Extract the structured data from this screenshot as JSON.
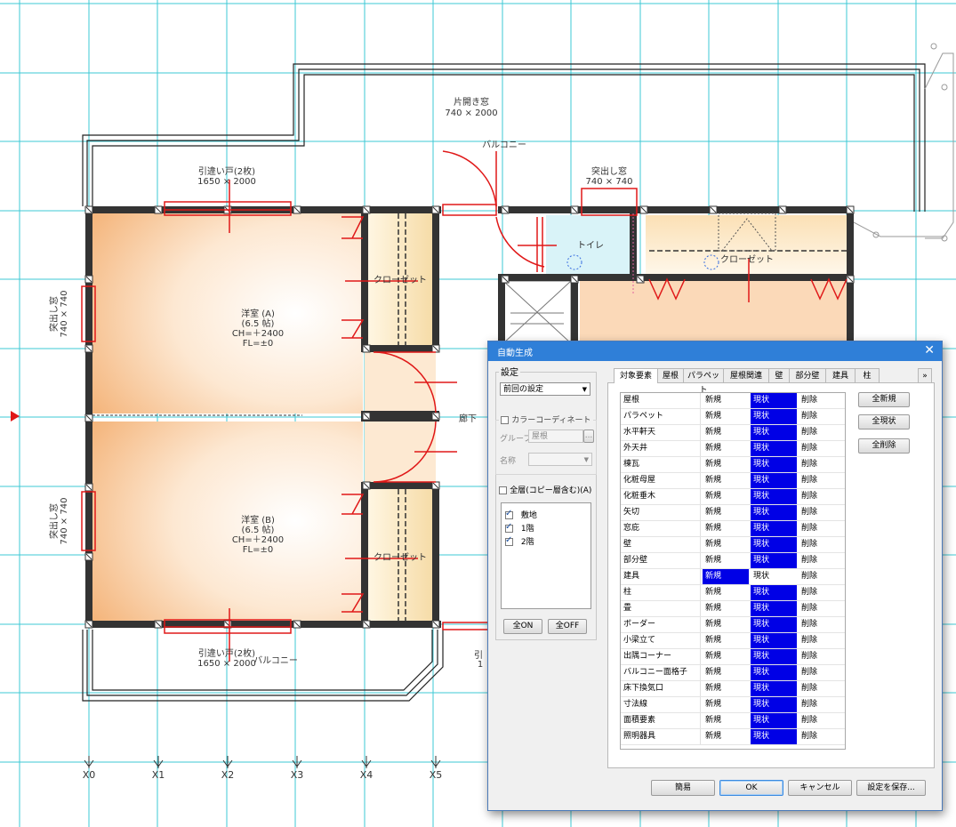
{
  "drawing": {
    "labels": {
      "window_top": "片開き窓",
      "window_top_size": "740 × 2000",
      "balcony_top": "バルコニー",
      "sliding_door_top": "引違い戸(2枚)",
      "sliding_door_top_size": "1650 × 2000",
      "bay_window_top": "突出し窓",
      "bay_window_top_size": "740 × 740",
      "toilet": "トイレ",
      "closet_right": "クローゼット",
      "closet_a": "クローゼット",
      "closet_b": "クローゼット",
      "bay_window_left_a": "突出し窓",
      "bay_window_left_a_size": "740 × 740",
      "bay_window_left_b": "突出し窓",
      "bay_window_left_b_size": "740 × 740",
      "room_a_name": "洋室 (A)",
      "room_a_size": "(6.5 帖)",
      "room_a_ch": "CH=＋2400",
      "room_a_fl": "FL=±0",
      "room_b_name": "洋室 (B)",
      "room_b_size": "(6.5 帖)",
      "room_b_ch": "CH=＋2400",
      "room_b_fl": "FL=±0",
      "corridor": "廊下",
      "sliding_door_bottom": "引違い戸(2枚)",
      "sliding_door_bottom_size": "1650 × 2000",
      "balcony_bottom": "バルコニー",
      "cut_off_label": "引",
      "cut_off_size": "1"
    },
    "axes": [
      "X0",
      "X1",
      "X2",
      "X3",
      "X4",
      "X5"
    ]
  },
  "dialog": {
    "title": "自動生成",
    "settings_label": "設定",
    "settings_value": "前回の設定",
    "color_coordinate": "カラーコーディネート",
    "group_label": "グループ",
    "group_value": "屋根",
    "group_button": "...",
    "name_label": "名称",
    "name_value": "",
    "all_floors": "全層(コピー層含む)(A)",
    "layers": [
      {
        "name": "敷地",
        "checked": true
      },
      {
        "name": "1階",
        "checked": true
      },
      {
        "name": "2階",
        "checked": true
      }
    ],
    "all_on": "全ON",
    "all_off": "全OFF",
    "tabs": [
      "対象要素",
      "屋根",
      "パラペット",
      "屋根関連",
      "壁",
      "部分壁",
      "建具",
      "柱"
    ],
    "tab_more": "»",
    "rows": [
      {
        "name": "屋根",
        "new": "新規",
        "current": "現状",
        "delete": "削除",
        "selected": "current"
      },
      {
        "name": "パラペット",
        "new": "新規",
        "current": "現状",
        "delete": "削除",
        "selected": "current"
      },
      {
        "name": "水平軒天",
        "new": "新規",
        "current": "現状",
        "delete": "削除",
        "selected": "current"
      },
      {
        "name": "外天井",
        "new": "新規",
        "current": "現状",
        "delete": "削除",
        "selected": "current"
      },
      {
        "name": "棟瓦",
        "new": "新規",
        "current": "現状",
        "delete": "削除",
        "selected": "current"
      },
      {
        "name": "化粧母屋",
        "new": "新規",
        "current": "現状",
        "delete": "削除",
        "selected": "current"
      },
      {
        "name": "化粧垂木",
        "new": "新規",
        "current": "現状",
        "delete": "削除",
        "selected": "current"
      },
      {
        "name": "矢切",
        "new": "新規",
        "current": "現状",
        "delete": "削除",
        "selected": "current"
      },
      {
        "name": "窓庇",
        "new": "新規",
        "current": "現状",
        "delete": "削除",
        "selected": "current"
      },
      {
        "name": "壁",
        "new": "新規",
        "current": "現状",
        "delete": "削除",
        "selected": "current"
      },
      {
        "name": "部分壁",
        "new": "新規",
        "current": "現状",
        "delete": "削除",
        "selected": "current"
      },
      {
        "name": "建具",
        "new": "新規",
        "current": "現状",
        "delete": "削除",
        "selected": "new"
      },
      {
        "name": "柱",
        "new": "新規",
        "current": "現状",
        "delete": "削除",
        "selected": "current"
      },
      {
        "name": "畳",
        "new": "新規",
        "current": "現状",
        "delete": "削除",
        "selected": "current"
      },
      {
        "name": "ボーダー",
        "new": "新規",
        "current": "現状",
        "delete": "削除",
        "selected": "current"
      },
      {
        "name": "小梁立て",
        "new": "新規",
        "current": "現状",
        "delete": "削除",
        "selected": "current"
      },
      {
        "name": "出隅コーナー",
        "new": "新規",
        "current": "現状",
        "delete": "削除",
        "selected": "current"
      },
      {
        "name": "バルコニー面格子",
        "new": "新規",
        "current": "現状",
        "delete": "削除",
        "selected": "current"
      },
      {
        "name": "床下換気口",
        "new": "新規",
        "current": "現状",
        "delete": "削除",
        "selected": "current"
      },
      {
        "name": "寸法線",
        "new": "新規",
        "current": "現状",
        "delete": "削除",
        "selected": "current"
      },
      {
        "name": "面積要素",
        "new": "新規",
        "current": "現状",
        "delete": "削除",
        "selected": "current"
      },
      {
        "name": "照明器具",
        "new": "新規",
        "current": "現状",
        "delete": "削除",
        "selected": "current"
      }
    ],
    "all_new": "全新規",
    "all_current": "全現状",
    "all_delete": "全削除",
    "btn_simple": "簡易",
    "btn_ok": "OK",
    "btn_cancel": "キャンセル",
    "btn_save": "設定を保存..."
  },
  "colors": {
    "grid": "#3ec9d4",
    "wall": "#333333",
    "fitting": "#e01818",
    "selection": "#0000e6",
    "title_bar": "#2f7fd8"
  }
}
